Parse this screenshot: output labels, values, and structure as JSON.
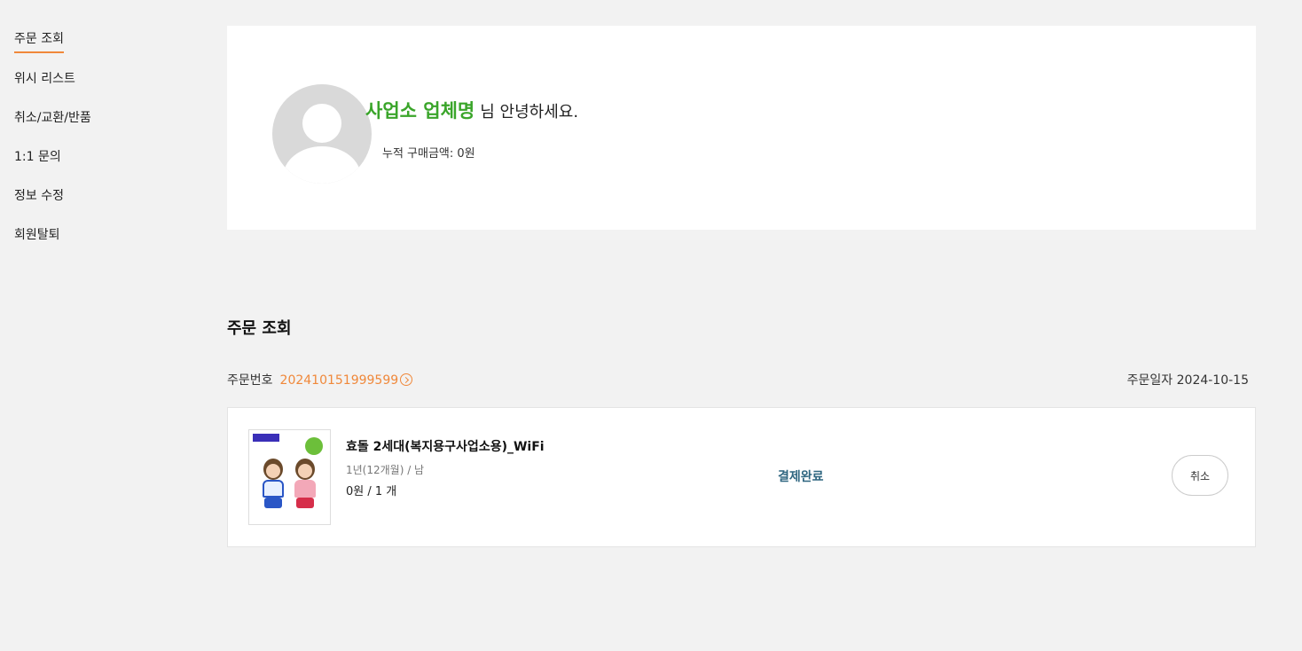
{
  "sidebar": {
    "items": [
      {
        "label": "주문 조회",
        "active": true
      },
      {
        "label": "위시 리스트"
      },
      {
        "label": "취소/교환/반품"
      },
      {
        "label": "1:1 문의"
      },
      {
        "label": "정보 수정"
      },
      {
        "label": "회원탈퇴"
      }
    ]
  },
  "profile": {
    "name": "사업소 업체명",
    "greeting_suffix": "님 안녕하세요.",
    "total_purchase": "누적 구매금액: 0원"
  },
  "orders_section": {
    "title": "주문 조회",
    "order_number_label": "주문번호",
    "order_number": "202410151999599",
    "order_date_label": "주문일자",
    "order_date": "2024-10-15"
  },
  "order_item": {
    "name": "효돌 2세대(복지용구사업소용)_WiFi",
    "option": "1년(12개월) / 남",
    "price_qty": "0원 / 1 개",
    "status": "결제완료",
    "cancel_label": "취소"
  },
  "colors": {
    "accent_orange": "#f0883a",
    "name_green": "#3aa52a",
    "status_blue": "#2f6680"
  }
}
